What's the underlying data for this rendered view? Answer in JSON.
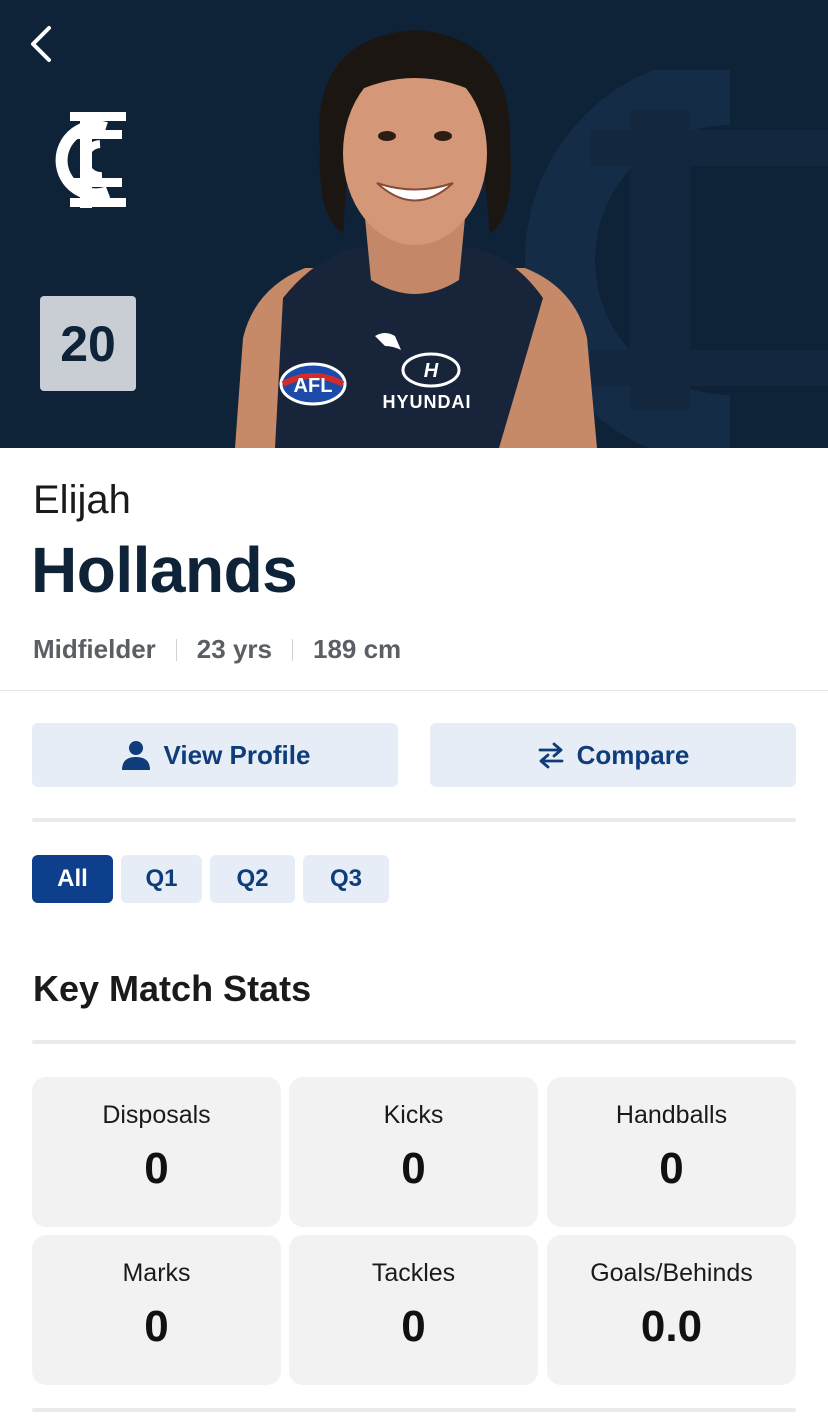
{
  "player": {
    "number": "20",
    "first_name": "Elijah",
    "last_name": "Hollands",
    "position": "Midfielder",
    "age": "23 yrs",
    "height": "189 cm",
    "sponsor_text": "HYUNDAI",
    "league_badge": "AFL"
  },
  "actions": {
    "view_profile": "View Profile",
    "compare": "Compare"
  },
  "tabs": [
    {
      "label": "All",
      "active": true
    },
    {
      "label": "Q1",
      "active": false
    },
    {
      "label": "Q2",
      "active": false
    },
    {
      "label": "Q3",
      "active": false
    }
  ],
  "stats": {
    "title": "Key Match Stats",
    "items": [
      {
        "label": "Disposals",
        "value": "0"
      },
      {
        "label": "Kicks",
        "value": "0"
      },
      {
        "label": "Handballs",
        "value": "0"
      },
      {
        "label": "Marks",
        "value": "0"
      },
      {
        "label": "Tackles",
        "value": "0"
      },
      {
        "label": "Goals/Behinds",
        "value": "0.0"
      }
    ]
  },
  "icons": {
    "back": "chevron-left-icon",
    "profile": "person-icon",
    "compare": "swap-arrows-icon"
  },
  "colors": {
    "hero_bg": "#0e2238",
    "accent": "#0e3f8c",
    "button_bg": "#e6edf6",
    "card_bg": "#f2f2f3"
  }
}
